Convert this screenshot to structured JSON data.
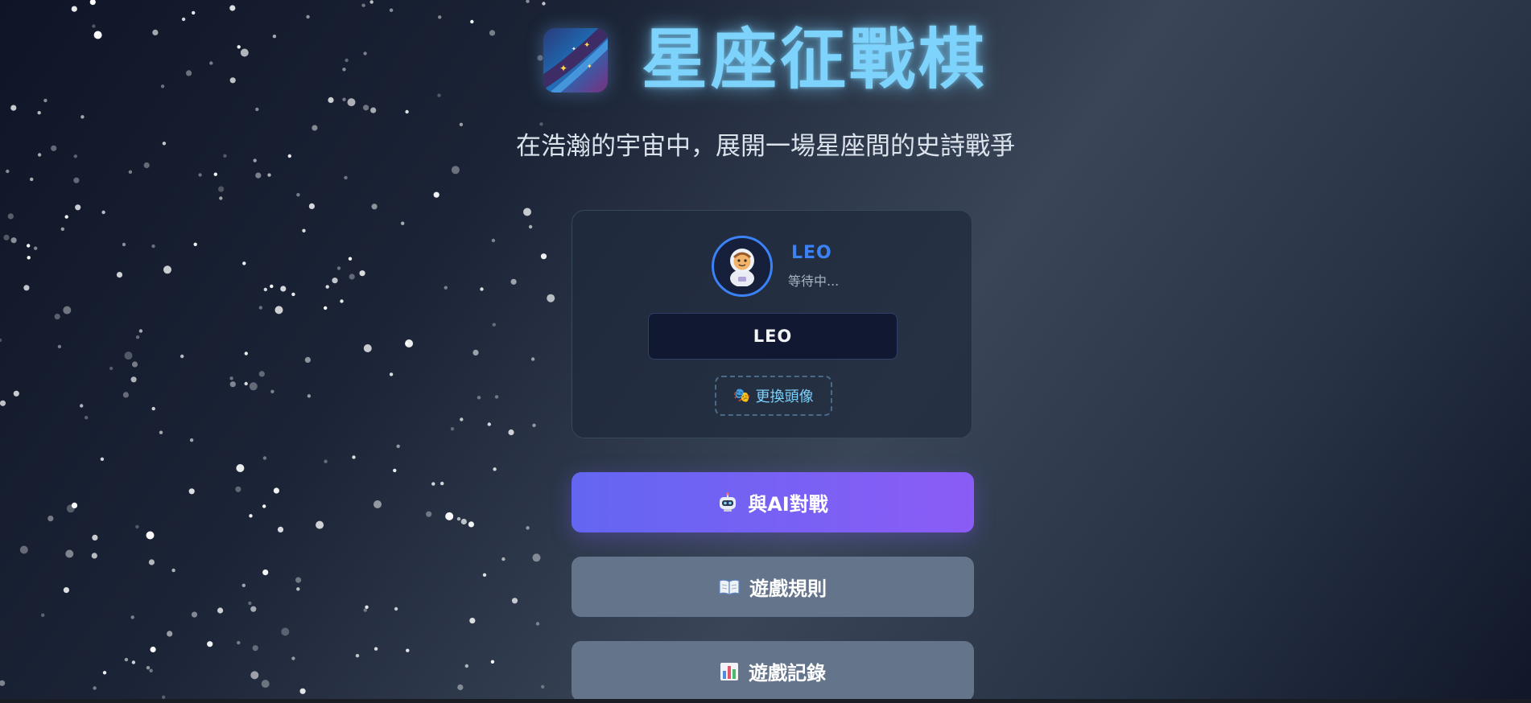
{
  "header": {
    "title": "星座征戰棋",
    "subtitle": "在浩瀚的宇宙中，展開一場星座間的史詩戰爭",
    "logo_icon": "galaxy-icon"
  },
  "player": {
    "avatar_icon": "astronaut-icon",
    "name": "LEO",
    "status": "等待中...",
    "name_input_value": "LEO",
    "change_avatar_label": "更換頭像",
    "change_avatar_icon": "theater-masks-icon"
  },
  "menu": {
    "ai_battle_label": "與AI對戰",
    "ai_battle_icon": "robot-icon",
    "rules_label": "遊戲規則",
    "rules_icon": "open-book-icon",
    "history_label": "遊戲記錄",
    "history_icon": "bar-chart-icon"
  },
  "colors": {
    "title": "#7dd3fc",
    "accent_blue": "#3b82f6",
    "ai_button_start": "#6366f1",
    "ai_button_end": "#8b5cf6",
    "secondary_button": "#64748b"
  }
}
